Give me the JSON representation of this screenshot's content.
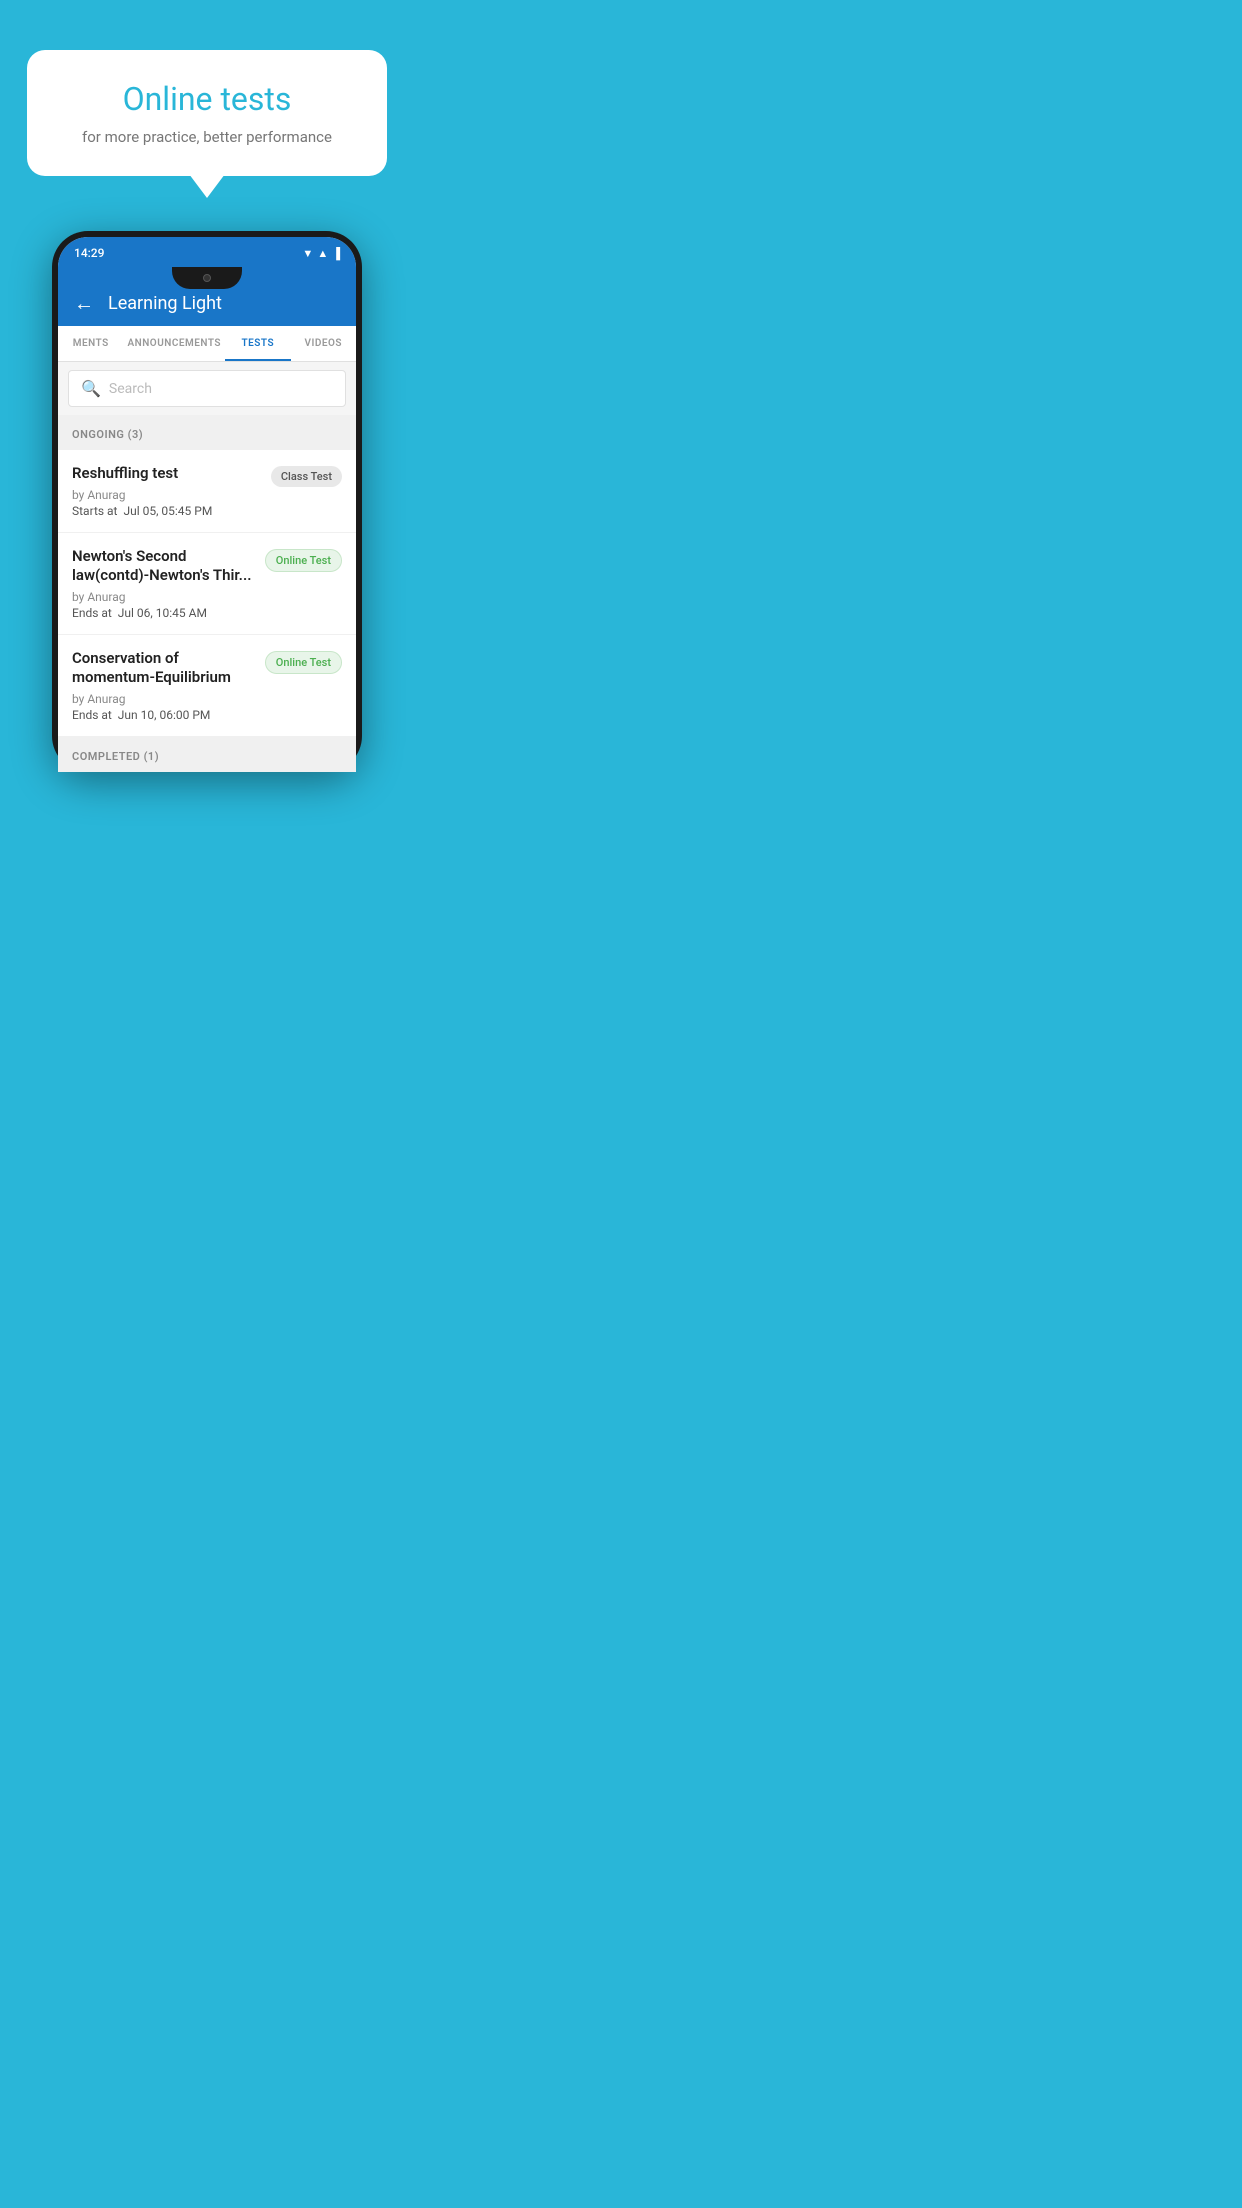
{
  "background": {
    "color": "#29b6d8"
  },
  "speech_bubble": {
    "title": "Online tests",
    "subtitle": "for more practice, better performance"
  },
  "status_bar": {
    "time": "14:29",
    "icons": [
      "wifi",
      "signal",
      "battery"
    ]
  },
  "app_header": {
    "title": "Learning Light",
    "back_label": "←"
  },
  "tabs": [
    {
      "label": "MENTS",
      "active": false
    },
    {
      "label": "ANNOUNCEMENTS",
      "active": false
    },
    {
      "label": "TESTS",
      "active": true
    },
    {
      "label": "VIDEOS",
      "active": false
    }
  ],
  "search": {
    "placeholder": "Search"
  },
  "ongoing_section": {
    "label": "ONGOING (3)"
  },
  "tests": [
    {
      "name": "Reshuffling test",
      "by": "by Anurag",
      "date_label": "Starts at",
      "date_value": "Jul 05, 05:45 PM",
      "badge": "Class Test",
      "badge_type": "class"
    },
    {
      "name": "Newton's Second law(contd)-Newton's Thir...",
      "by": "by Anurag",
      "date_label": "Ends at",
      "date_value": "Jul 06, 10:45 AM",
      "badge": "Online Test",
      "badge_type": "online"
    },
    {
      "name": "Conservation of momentum-Equilibrium",
      "by": "by Anurag",
      "date_label": "Ends at",
      "date_value": "Jun 10, 06:00 PM",
      "badge": "Online Test",
      "badge_type": "online"
    }
  ],
  "completed_section": {
    "label": "COMPLETED (1)"
  }
}
